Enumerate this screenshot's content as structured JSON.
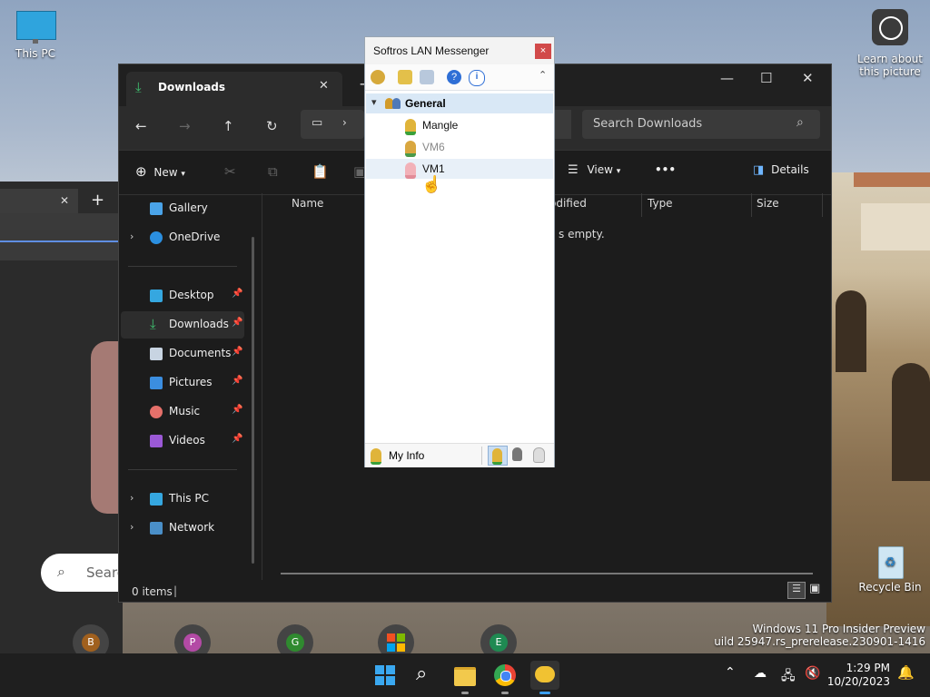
{
  "desktop": {
    "this_pc_label": "This PC",
    "learn_label_line1": "Learn about",
    "learn_label_line2": "this picture",
    "recycle_label": "Recycle Bin",
    "watermark_line1": "Windows 11 Pro Insider Preview",
    "watermark_line2": "uild 25947.rs_prerelease.230901-1416"
  },
  "chrome_bg": {
    "search_placeholder": "Searc",
    "new_tab_symbol": "+",
    "close_symbol": "✕",
    "shortcuts": [
      "B",
      "P",
      "G",
      "E"
    ],
    "shortcut_colors": [
      "#a0601e",
      "#b34aa5",
      "#2f8a2f",
      "#1f8a52"
    ]
  },
  "explorer": {
    "tab_title": "Downloads",
    "tab_close": "✕",
    "new_tab": "+",
    "search_placeholder": "Search Downloads",
    "cmd": {
      "new": "New",
      "view": "View",
      "more": "•••",
      "details": "Details"
    },
    "nav": {
      "gallery": "Gallery",
      "onedrive": "OneDrive",
      "desktop": "Desktop",
      "downloads": "Downloads",
      "documents": "Documents",
      "pictures": "Pictures",
      "music": "Music",
      "videos": "Videos",
      "thispc": "This PC",
      "network": "Network"
    },
    "columns": {
      "name": "Name",
      "modified": "odified",
      "type": "Type",
      "size": "Size"
    },
    "empty_text": "s empty.",
    "status": "0 items",
    "status_cursor": "|"
  },
  "messenger": {
    "title": "Softros LAN Messenger",
    "close": "×",
    "group": "General",
    "contacts": [
      {
        "name": "Mangle",
        "status": "online",
        "color": "#2e7d32"
      },
      {
        "name": "VM6",
        "status": "offline",
        "color": "#777777"
      },
      {
        "name": "VM1",
        "status": "busy",
        "color": "#1a1a1a"
      }
    ],
    "my_info": "My Info"
  },
  "taskbar": {
    "time": "1:29 PM",
    "date": "10/20/2023",
    "accent": "#3a9ff0"
  }
}
